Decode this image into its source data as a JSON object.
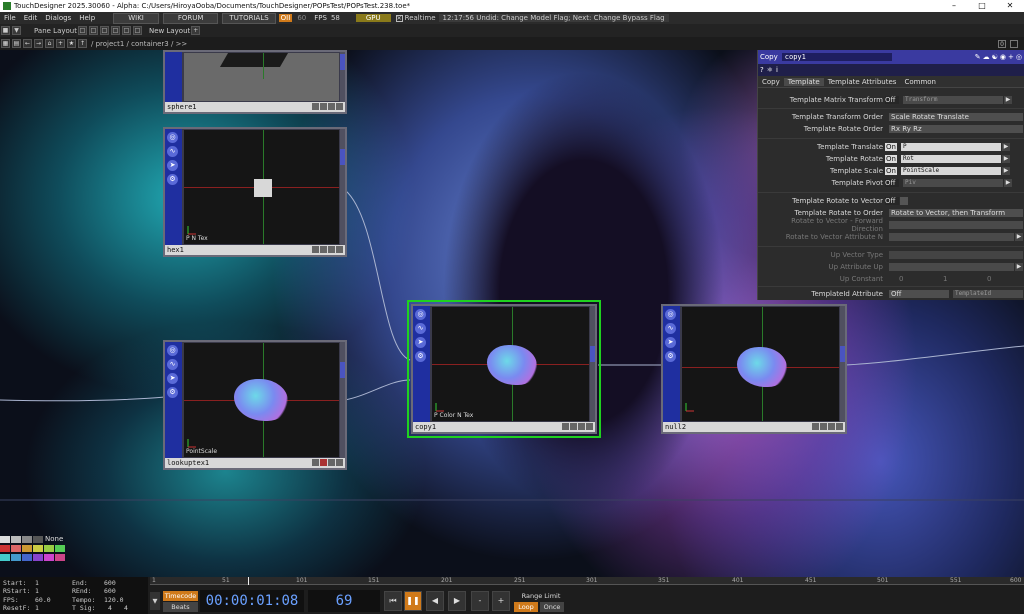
{
  "titlebar": {
    "title": "TouchDesigner 2025.30060 - Alpha: C:/Users/HiroyaOoba/Documents/TouchDesigner/POPsTest/POPsTest.238.toe*"
  },
  "menu": {
    "file": "File",
    "edit": "Edit",
    "dialogs": "Dialogs",
    "help": "Help",
    "wiki": "WIKI",
    "forum": "FORUM",
    "tutorials": "TUTORIALS",
    "oi": "OII",
    "warn": "60",
    "fps_label": "FPS",
    "fps": "58",
    "gpu": "GPU",
    "realtime": "Realtime",
    "status": "12:17:56 Undid: Change Model Flag; Next: Change Bypass Flag"
  },
  "toolbar": {
    "pane_layout": "Pane Layout",
    "new_layout": "New Layout"
  },
  "pathbar": {
    "path": "/ project1 / container3 / >>"
  },
  "nodes": {
    "sphere": {
      "name": "sphere1"
    },
    "hex": {
      "name": "hex1",
      "label": "P N Tex"
    },
    "lookup": {
      "name": "lookuptex1",
      "label": "PointScale"
    },
    "copy": {
      "name": "copy1",
      "label": "P Color N Tex"
    },
    "null": {
      "name": "null2"
    }
  },
  "params": {
    "optype": "Copy",
    "opname": "copy1",
    "tabs": [
      "Copy",
      "Template",
      "Template Attributes",
      "Common"
    ],
    "rows": [
      {
        "label": "Template Matrix Transform",
        "toggle": "Off",
        "field": "Transform"
      },
      {
        "label": "Template Transform Order",
        "menu": "Scale Rotate Translate"
      },
      {
        "label": "Template Rotate Order",
        "menu": "Rx Ry Rz"
      },
      {
        "label": "Template Translate",
        "toggle": "On",
        "field": "P"
      },
      {
        "label": "Template Rotate",
        "toggle": "On",
        "field": "Rot"
      },
      {
        "label": "Template Scale",
        "toggle": "On",
        "field": "PointScale"
      },
      {
        "label": "Template Pivot",
        "toggle": "Off",
        "field": "Piv"
      },
      {
        "label": "Template Rotate to Vector",
        "toggle": "Off"
      },
      {
        "label": "Template Rotate to Order",
        "menu": "Rotate to Vector, then Transform"
      },
      {
        "label": "Rotate to Vector - Forward Direction"
      },
      {
        "label": "Rotate to Vector Attribute N"
      },
      {
        "label": "Up Vector Type"
      },
      {
        "label": "Up Attribute Up"
      },
      {
        "label": "Up Constant",
        "v1": "0",
        "v2": "1",
        "v3": "0"
      },
      {
        "label": "TemplateId Attribute",
        "menu": "Off",
        "field": "TemplateId"
      }
    ]
  },
  "stats": {
    "start_l": "Start:",
    "start": "1",
    "rstart_l": "RStart:",
    "rstart": "1",
    "fps_l": "FPS:",
    "fps": "60.0",
    "resetf_l": "ResetF:",
    "resetf": "1",
    "end_l": "End:",
    "end": "600",
    "rend_l": "REnd:",
    "rend": "600",
    "tempo_l": "Tempo:",
    "tempo": "120.0",
    "tsig_l": "T Sig:",
    "tsig1": "4",
    "tsig2": "4"
  },
  "palette": {
    "none": "None"
  },
  "ruler": [
    "1",
    "51",
    "101",
    "151",
    "201",
    "251",
    "301",
    "351",
    "401",
    "451",
    "501",
    "551",
    "600"
  ],
  "timeline": {
    "timecode_btn": "Timecode",
    "beats_btn": "Beats",
    "timecode": "00:00:01:08",
    "frame": "69",
    "range_limit": "Range Limit",
    "loop": "Loop",
    "once": "Once"
  }
}
